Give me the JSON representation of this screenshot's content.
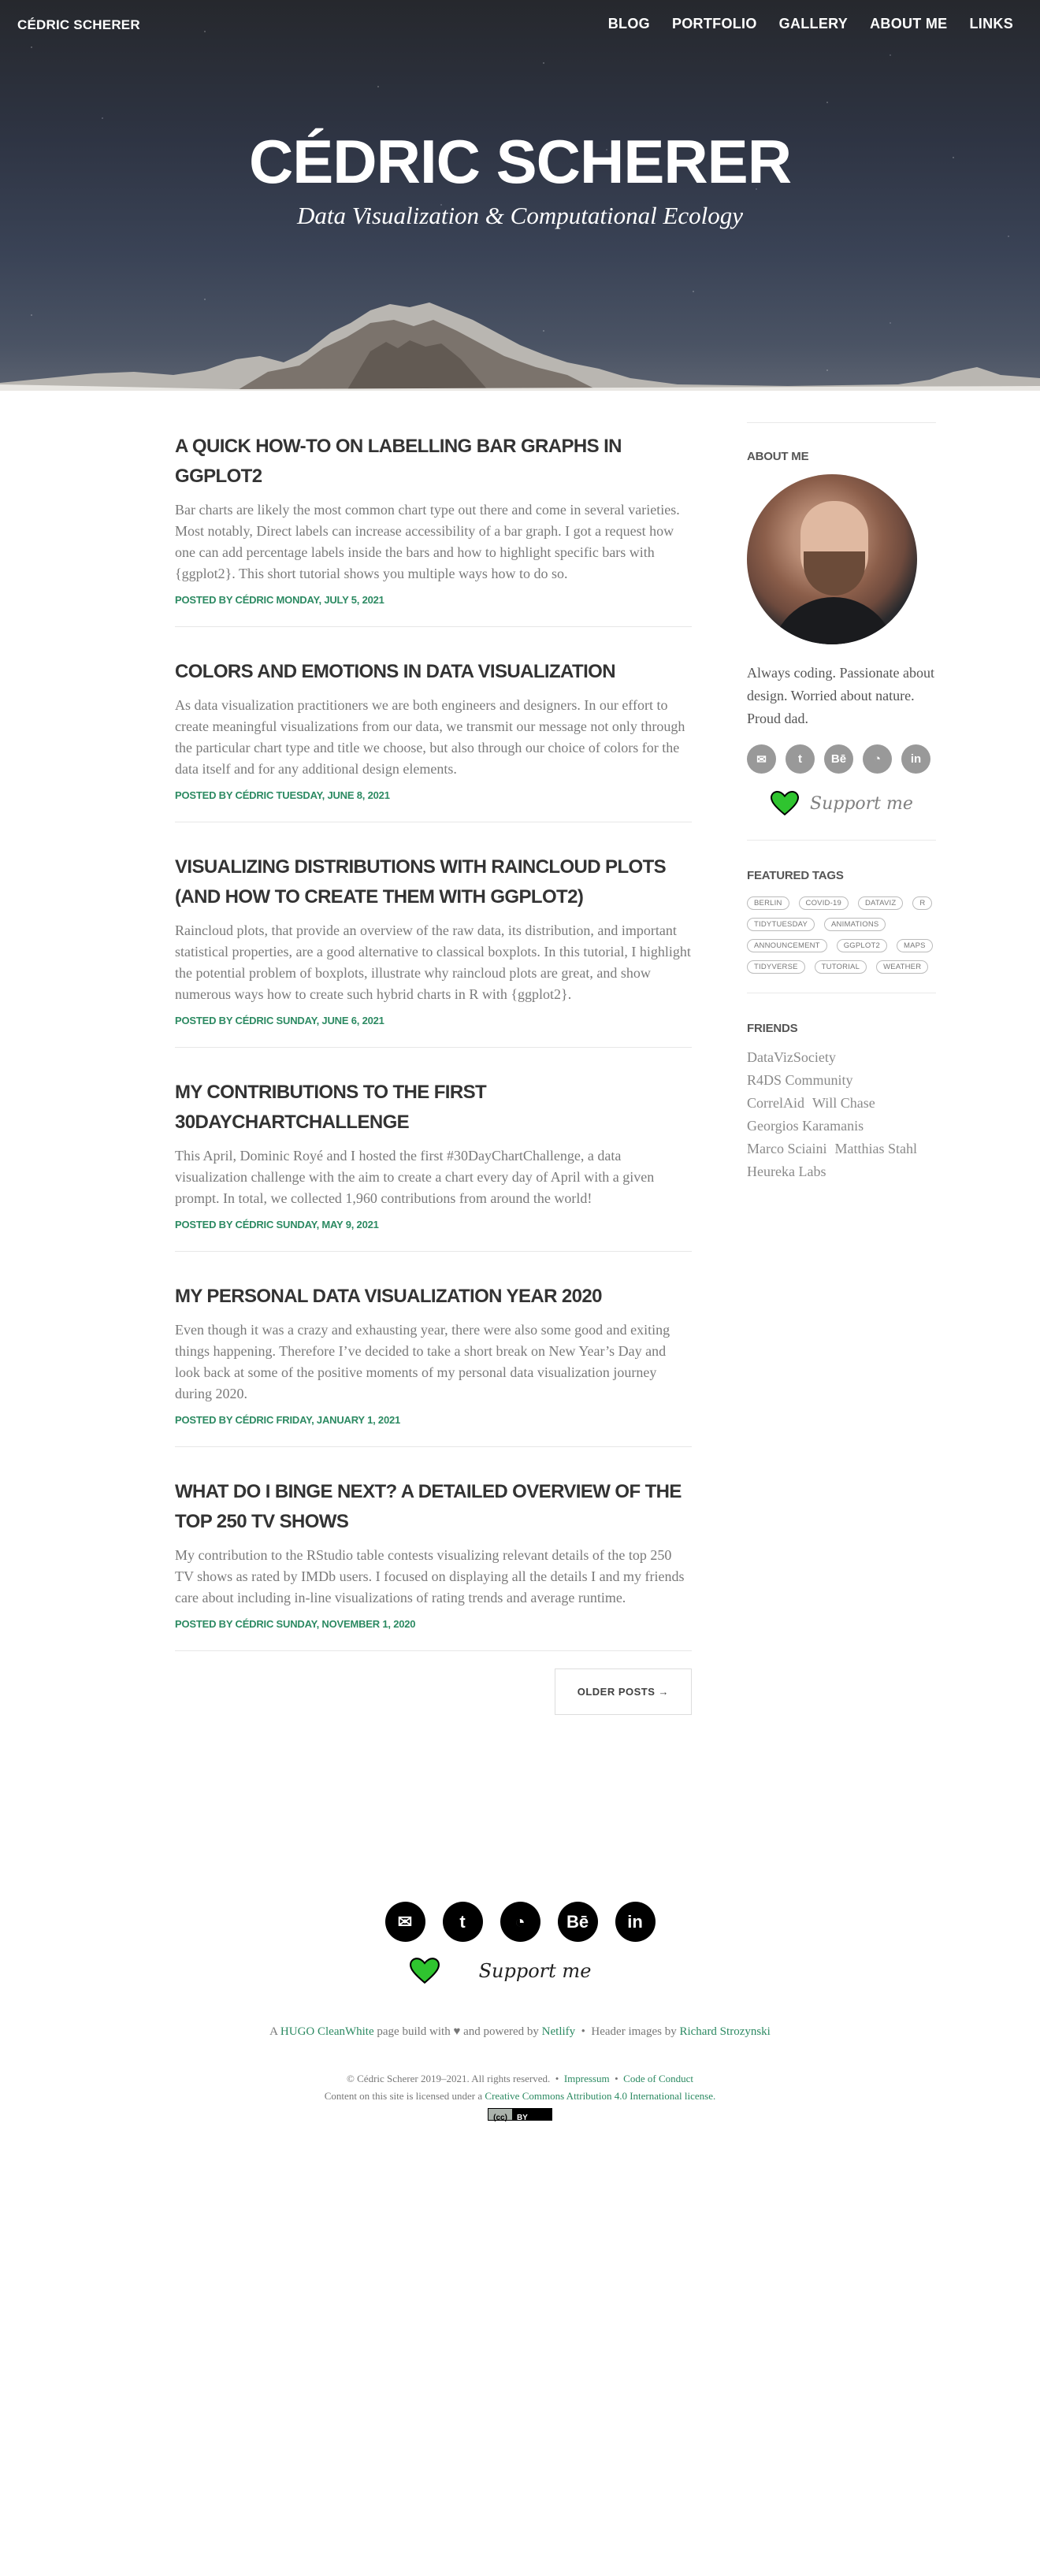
{
  "site": {
    "brand": "CÉDRIC SCHERER",
    "title": "CÉDRIC SCHERER",
    "subtitle": "Data Visualization & Computational Ecology"
  },
  "nav": [
    "BLOG",
    "PORTFOLIO",
    "GALLERY",
    "ABOUT ME",
    "LINKS"
  ],
  "posts": [
    {
      "title": "A QUICK HOW-TO ON LABELLING BAR GRAPHS IN GGPLOT2",
      "excerpt": "Bar charts are likely the most common chart type out there and come in several varieties. Most notably, Direct labels can increase accessibility of a bar graph. I got a request how one can add percentage labels inside the bars and how to highlight specific bars with {ggplot2}. This short tutorial shows you multiple ways how to do so.",
      "meta": "POSTED BY CÉDRIC MONDAY, JULY 5, 2021"
    },
    {
      "title": "COLORS AND EMOTIONS IN DATA VISUALIZATION",
      "excerpt": "As data visualization practitioners we are both engineers and designers. In our effort to create meaningful visualizations from our data, we transmit our message not only through the particular chart type and title we choose, but also through our choice of colors for the data itself and for any additional design elements.",
      "meta": "POSTED BY CÉDRIC TUESDAY, JUNE 8, 2021"
    },
    {
      "title": "VISUALIZING DISTRIBUTIONS WITH RAINCLOUD PLOTS (AND HOW TO CREATE THEM WITH GGPLOT2)",
      "excerpt": "Raincloud plots, that provide an overview of the raw data, its distribution, and important statistical properties, are a good alternative to classical boxplots. In this tutorial, I highlight the potential problem of boxplots, illustrate why raincloud plots are great, and show numerous ways how to create such hybrid charts in R with {ggplot2}.",
      "meta": "POSTED BY CÉDRIC SUNDAY, JUNE 6, 2021"
    },
    {
      "title": "MY CONTRIBUTIONS TO THE FIRST 30DAYCHARTCHALLENGE",
      "excerpt": "This April, Dominic Royé and I hosted the first #30DayChartChallenge, a data visualization challenge with the aim to create a chart every day of April with a given prompt. In total, we collected 1,960 contributions from around the world!",
      "meta": "POSTED BY CÉDRIC SUNDAY, MAY 9, 2021"
    },
    {
      "title": "MY PERSONAL DATA VISUALIZATION YEAR 2020",
      "excerpt": "Even though it was a crazy and exhausting year, there were also some good and exiting things happening. Therefore I’ve decided to take a short break on New Year’s Day and look back at some of the positive moments of my personal data visualization journey during 2020.",
      "meta": "POSTED BY CÉDRIC FRIDAY, JANUARY 1, 2021"
    },
    {
      "title": "WHAT DO I BINGE NEXT? A DETAILED OVERVIEW OF THE TOP 250 TV SHOWS",
      "excerpt": "My contribution to the RStudio table contests visualizing relevant details of the top 250 TV shows as rated by IMDb users. I focused on displaying all the details I and my friends care about including in-line visualizations of rating trends and average runtime.",
      "meta": "POSTED BY CÉDRIC SUNDAY, NOVEMBER 1, 2020"
    }
  ],
  "pager": {
    "older": "OLDER POSTS →"
  },
  "sidebar": {
    "about_heading": "ABOUT ME",
    "bio": "Always coding. Passionate about design. Worried about nature. Proud dad.",
    "social": [
      {
        "name": "email-icon",
        "glyph": "✉"
      },
      {
        "name": "twitter-icon",
        "glyph": "t"
      },
      {
        "name": "behance-icon",
        "glyph": "Bē"
      },
      {
        "name": "github-icon",
        "glyph": "◔"
      },
      {
        "name": "linkedin-icon",
        "glyph": "in"
      }
    ],
    "support": "Support me",
    "tags_heading": "FEATURED TAGS",
    "tags": [
      "BERLIN",
      "COVID-19",
      "DATAVIZ",
      "R",
      "TIDYTUESDAY",
      "ANIMATIONS",
      "ANNOUNCEMENT",
      "GGPLOT2",
      "MAPS",
      "TIDYVERSE",
      "TUTORIAL",
      "WEATHER"
    ],
    "friends_heading": "FRIENDS",
    "friends": [
      "DataVizSociety",
      "R4DS Community",
      "CorrelAid",
      "Will Chase",
      "Georgios Karamanis",
      "Marco Sciaini",
      "Matthias Stahl",
      "Heureka Labs"
    ]
  },
  "footer": {
    "social": [
      {
        "name": "email-icon",
        "glyph": "✉"
      },
      {
        "name": "twitter-icon",
        "glyph": "t"
      },
      {
        "name": "github-icon",
        "glyph": "◔"
      },
      {
        "name": "behance-icon",
        "glyph": "Bē"
      },
      {
        "name": "linkedin-icon",
        "glyph": "in"
      }
    ],
    "support": "Support me",
    "credits": {
      "prefix": "A ",
      "theme": "HUGO CleanWhite",
      "mid": " page build with ♥ and powered by ",
      "host": "Netlify",
      "sep": "  •  Header images by ",
      "photographer": "Richard Strozynski"
    },
    "copyright": {
      "text": "© Cédric Scherer 2019–2021. All rights reserved.",
      "sep1": "  •  ",
      "impressum": "Impressum",
      "sep2": "  •  ",
      "conduct": "Code of Conduct",
      "license_prefix": "Content on this site is licensed under a ",
      "license": "Creative Commons Attribution 4.0 International license.",
      "badge_left": "(cc)",
      "badge_right": "BY"
    }
  },
  "colors": {
    "accent": "#2c8a62",
    "heart": "#2fc42f",
    "icon_grey": "#999999"
  }
}
